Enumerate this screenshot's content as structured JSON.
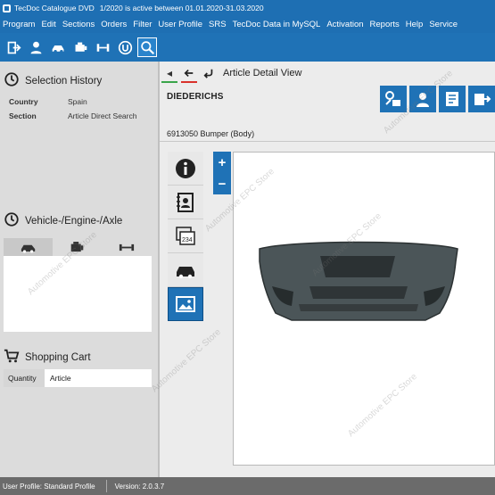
{
  "window": {
    "title": "TecDoc Catalogue DVD",
    "subtitle": "1/2020 is active between 01.01.2020-31.03.2020"
  },
  "menu": [
    "Program",
    "Edit",
    "Sections",
    "Orders",
    "Filter",
    "User Profile",
    "SRS",
    "TecDoc Data in MySQL",
    "Activation",
    "Reports",
    "Help",
    "Service"
  ],
  "toolbar": {
    "icons": [
      "exit-icon",
      "user-icon",
      "car-parts-icon",
      "engine-icon",
      "axle-icon",
      "brand-u-icon",
      "search-zoom-icon"
    ]
  },
  "selection_history": {
    "title": "Selection History",
    "rows": [
      {
        "label": "Country",
        "value": "Spain"
      },
      {
        "label": "Section",
        "value": "Article Direct Search"
      }
    ]
  },
  "vehicle": {
    "title": "Vehicle-/Engine-/Axle"
  },
  "cart": {
    "title": "Shopping Cart",
    "col_quantity": "Quantity",
    "col_article": "Article"
  },
  "article_view": {
    "title": "Article Detail View",
    "brand": "DIEDERICHS",
    "article_line": "6913050 Bumper (Body)",
    "zoom_in": "+",
    "zoom_out": "−"
  },
  "watermark": "Automotive EPC Store",
  "status": {
    "profile": "User Profile: Standard Profile",
    "version": "Version: 2.0.3.7"
  },
  "colors": {
    "accent": "#1f72b6",
    "status_bar": "#6b6b6b",
    "nav_back": "#3aa54a",
    "nav_forward": "#d9322b"
  }
}
